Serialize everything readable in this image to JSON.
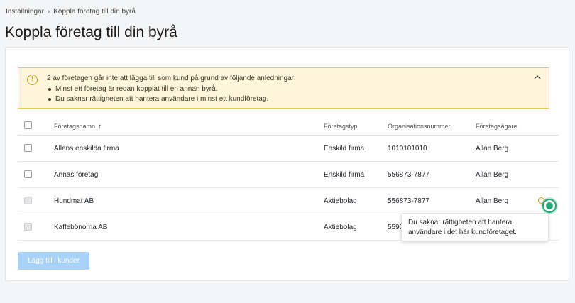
{
  "breadcrumb": {
    "items": [
      "Inställningar",
      "Koppla företag till din byrå"
    ],
    "separator": "›"
  },
  "page": {
    "title": "Koppla företag till din byrå"
  },
  "alert": {
    "title": "2 av företagen går inte att lägga till som kund på grund av följande anledningar:",
    "reasons": [
      "Minst ett företag är redan kopplat till en annan byrå.",
      "Du saknar rättigheten att hantera användare i minst ett kundföretag."
    ],
    "icon": "warning-icon",
    "collapse_icon": "chevron-up-icon",
    "color": "#f0c44d"
  },
  "table": {
    "columns": {
      "name": "Företagsnamn",
      "type": "Företagstyp",
      "org": "Organisationsnummer",
      "owner": "Företagsägare"
    },
    "sort": {
      "column": "name",
      "direction": "asc",
      "icon": "↑"
    },
    "rows": [
      {
        "name": "Allans enskilda firma",
        "type": "Enskild firma",
        "org": "1010101010",
        "owner": "Allan Berg",
        "disabled": false
      },
      {
        "name": "Annas företag",
        "type": "Enskild firma",
        "org": "556873-7877",
        "owner": "Allan Berg",
        "disabled": false
      },
      {
        "name": "Hundmat AB",
        "type": "Aktiebolag",
        "org": "556873-7877",
        "owner": "Allan Berg",
        "disabled": true
      },
      {
        "name": "Kaffebönorna AB",
        "type": "Aktiebolag",
        "org": "5590",
        "owner": "",
        "disabled": true
      }
    ]
  },
  "tooltip": {
    "text": "Du saknar rättigheten att hantera användare i det här kundföretaget."
  },
  "actions": {
    "add_label": "Lägg till i kunder",
    "add_color": "#a9d2f8"
  }
}
